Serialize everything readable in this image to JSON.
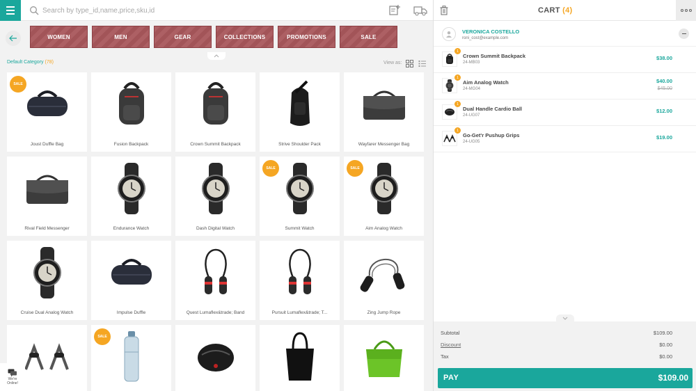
{
  "search": {
    "placeholder": "Search by type_id,name,price,sku,id"
  },
  "categories": [
    {
      "label": "WOMEN"
    },
    {
      "label": "MEN"
    },
    {
      "label": "GEAR"
    },
    {
      "label": "COLLECTIONS"
    },
    {
      "label": "PROMOTIONS"
    },
    {
      "label": "SALE"
    }
  ],
  "catalog": {
    "category_name": "Default Category",
    "category_count": "(78)",
    "view_as_label": "View as:",
    "sale_badge": "SALE",
    "products": [
      {
        "name": "Joust Duffle Bag",
        "icon": "duffle-bag-icon",
        "sale": true
      },
      {
        "name": "Fusion Backpack",
        "icon": "backpack-icon",
        "sale": false
      },
      {
        "name": "Crown Summit Backpack",
        "icon": "backpack-icon",
        "sale": false
      },
      {
        "name": "Strive Shoulder Pack",
        "icon": "shoulder-pack-icon",
        "sale": false
      },
      {
        "name": "Wayfarer Messenger Bag",
        "icon": "messenger-bag-icon",
        "sale": false
      },
      {
        "name": "Rival Field Messenger",
        "icon": "messenger-bag-icon",
        "sale": false
      },
      {
        "name": "Endurance Watch",
        "icon": "watch-icon",
        "sale": false
      },
      {
        "name": "Dash Digital Watch",
        "icon": "watch-icon",
        "sale": false
      },
      {
        "name": "Summit Watch",
        "icon": "watch-icon",
        "sale": true
      },
      {
        "name": "Aim Analog Watch",
        "icon": "watch-icon",
        "sale": true
      },
      {
        "name": "Cruise Dual Analog Watch",
        "icon": "watch-icon",
        "sale": false
      },
      {
        "name": "Impulse Duffle",
        "icon": "duffle-bag-icon",
        "sale": false
      },
      {
        "name": "Quest Lumaflex&trade; Band",
        "icon": "resistance-band-icon",
        "sale": false
      },
      {
        "name": "Pursuit Lumaflex&trade; T...",
        "icon": "resistance-band-icon",
        "sale": false
      },
      {
        "name": "Zing Jump Rope",
        "icon": "jump-rope-icon",
        "sale": false
      },
      {
        "name": "",
        "icon": "pushup-grips-icon",
        "sale": false
      },
      {
        "name": "",
        "icon": "water-bottle-icon",
        "sale": true
      },
      {
        "name": "",
        "icon": "cardio-ball-icon",
        "sale": false
      },
      {
        "name": "",
        "icon": "tote-bag-icon",
        "sale": false
      },
      {
        "name": "",
        "icon": "gym-bag-icon",
        "sale": false
      }
    ]
  },
  "chat": {
    "line1": "We're",
    "line2": "Online!"
  },
  "cart": {
    "title": "CART",
    "count": "(4)",
    "customer": {
      "name": "VERONICA COSTELLO",
      "email": "roni_cost@example.com"
    },
    "items": [
      {
        "qty": "1",
        "name": "Crown Summit Backpack",
        "sku": "24-MB03",
        "price": "$38.00",
        "old_price": ""
      },
      {
        "qty": "1",
        "name": "Aim Analog Watch",
        "sku": "24-MG04",
        "price": "$40.00",
        "old_price": "$45.00"
      },
      {
        "qty": "1",
        "name": "Dual Handle Cardio Ball",
        "sku": "24-UG07",
        "price": "$12.00",
        "old_price": ""
      },
      {
        "qty": "1",
        "name": "Go-Get'r Pushup Grips",
        "sku": "24-UG05",
        "price": "$19.00",
        "old_price": ""
      }
    ],
    "totals": {
      "subtotal_label": "Subtotal",
      "subtotal": "$109.00",
      "discount_label": "Discount",
      "discount": "$0.00",
      "tax_label": "Tax",
      "tax": "$0.00"
    },
    "pay_label": "PAY",
    "pay_total": "$109.00"
  },
  "colors": {
    "accent": "#1aa79c",
    "badge": "#f5a623",
    "category_bg": "#a9575c"
  }
}
